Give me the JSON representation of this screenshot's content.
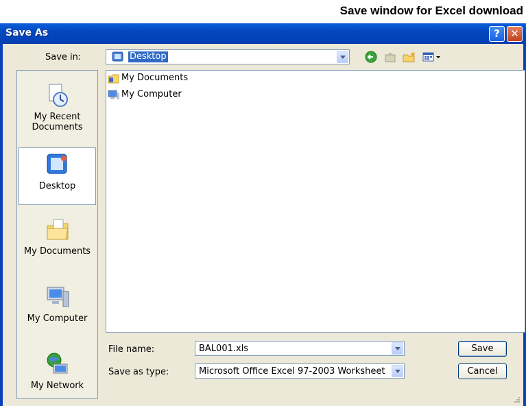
{
  "caption": "Save window for Excel download",
  "window": {
    "title": "Save As",
    "help_glyph": "?",
    "close_glyph": "✕"
  },
  "save_in": {
    "label": "Save in:",
    "value": "Desktop"
  },
  "toolbar_icons": [
    "back-icon",
    "up-folder-icon",
    "new-folder-icon",
    "views-menu-icon"
  ],
  "places": [
    {
      "label": "My Recent Documents",
      "icon": "recent-documents-icon"
    },
    {
      "label": "Desktop",
      "icon": "desktop-icon",
      "selected": true
    },
    {
      "label": "My Documents",
      "icon": "my-documents-icon"
    },
    {
      "label": "My Computer",
      "icon": "my-computer-icon"
    },
    {
      "label": "My Network",
      "icon": "my-network-icon"
    }
  ],
  "file_list": [
    {
      "name": "My Documents",
      "icon": "my-documents-icon"
    },
    {
      "name": "My Computer",
      "icon": "my-computer-icon"
    }
  ],
  "file_name": {
    "label": "File name:",
    "value": "BAL001.xls"
  },
  "save_as_type": {
    "label": "Save as type:",
    "value": "Microsoft Office Excel 97-2003 Worksheet"
  },
  "buttons": {
    "save": "Save",
    "cancel": "Cancel"
  },
  "colors": {
    "titlebar": "#0a5fd8",
    "window_bg": "#ece9d8",
    "selection": "#316ac5"
  }
}
